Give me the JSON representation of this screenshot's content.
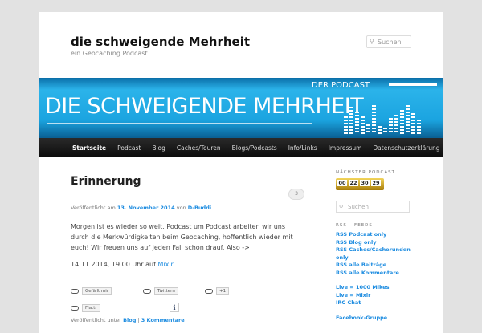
{
  "header": {
    "title": "die schweigende Mehrheit",
    "description": "ein Geocaching Podcast",
    "search_placeholder": "Suchen"
  },
  "banner": {
    "title": "DIE SCHWEIGENDE MEHRHEIT",
    "subtitle": "DER PODCAST"
  },
  "nav": [
    "Startseite",
    "Podcast",
    "Blog",
    "Caches/Touren",
    "Blogs/Podcasts",
    "Info/Links",
    "Impressum",
    "Datenschutzerklärung"
  ],
  "post": {
    "title": "Erinnerung",
    "comments_count": "3",
    "meta_prefix": "Veröffentlicht am",
    "date": "13. November 2014",
    "meta_by": "von",
    "author": "D-Buddi",
    "body": "Morgen ist es wieder so weit, Podcast um Podcast arbeiten wir uns durch die Merkwürdigkeiten beim Geocaching, hoffentlich wieder mit euch! Wir freuen uns auf jeden Fall schon drauf. Also ->",
    "when": "14.11.2014, 19.00 Uhr auf",
    "when_link": "Mixlr",
    "share": {
      "facebook": "Gefällt mir",
      "twitter": "Twittern",
      "gplus": "+1",
      "flattr": "Flattr",
      "info": "i"
    },
    "footer_prefix": "Veröffentlicht unter",
    "category": "Blog",
    "sep": "|",
    "comments_link": "3 Kommentare"
  },
  "sidebar": {
    "next_title": "NÄCHSTER PODCAST",
    "countdown": [
      "00",
      "22",
      "30",
      "29"
    ],
    "search_placeholder": "Suchen",
    "rss_title": "RSS – FEEDS",
    "rss": [
      "RSS Podcast only",
      "RSS Blog only",
      "RSS Caches/Cacherunden only",
      "RSS alle Beiträge",
      "RSS alle Kommentare"
    ],
    "live": [
      "Live = 1000 Mikes",
      "Live = Mixlr",
      "IRC Chat"
    ],
    "social": [
      "Facebook-Gruppe"
    ]
  }
}
